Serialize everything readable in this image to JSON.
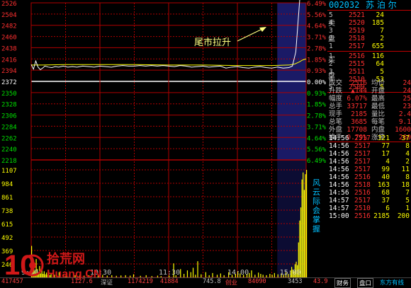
{
  "stock": {
    "code": "002032",
    "name": "苏 泊 尔"
  },
  "colors": {
    "up": "#ff3030",
    "down": "#00e000",
    "flat": "#ffffff",
    "grid": "#b00000",
    "price": "#ffffff",
    "avg": "#ffff00",
    "volume": "#ffff00",
    "label": "#00c0ff",
    "auction_bg": "#1a1a66"
  },
  "chart": {
    "price_ticks_left": [
      "2526",
      "2504",
      "2482",
      "2460",
      "2438",
      "2416",
      "2394",
      "2372",
      "2350",
      "2328",
      "2306",
      "2284",
      "2262",
      "2240",
      "2218"
    ],
    "pct_ticks_right": [
      "6.49%",
      "5.56%",
      "4.64%",
      "3.71%",
      "2.78%",
      "1.85%",
      "0.93%",
      "0.00%",
      "0.93%",
      "1.85%",
      "2.78%",
      "3.71%",
      "4.64%",
      "5.56%",
      "6.49%"
    ],
    "volume_ticks_left": [
      "1107",
      "984",
      "861",
      "738",
      "615",
      "492",
      "369",
      "246"
    ],
    "time_labels": [
      "9:30",
      "10:30",
      "11:30",
      "14:00",
      "15:00"
    ],
    "prev_close": 23.72,
    "price_range": [
      22.18,
      25.26
    ],
    "volume_max": 1230,
    "side_label": "风云际会掌握",
    "annotation": "尾市拉升",
    "price_series": [
      [
        0,
        24.05
      ],
      [
        2,
        23.96
      ],
      [
        4,
        24.12
      ],
      [
        6,
        24.0
      ],
      [
        8,
        23.95
      ],
      [
        10,
        23.98
      ],
      [
        12,
        24.02
      ],
      [
        15,
        24.0
      ],
      [
        18,
        23.99
      ],
      [
        21,
        24.01
      ],
      [
        24,
        24.0
      ],
      [
        28,
        24.02
      ],
      [
        32,
        24.0
      ],
      [
        36,
        24.01
      ],
      [
        40,
        24.0
      ],
      [
        45,
        24.02
      ],
      [
        50,
        24.01
      ],
      [
        55,
        24.0
      ],
      [
        60,
        24.02
      ],
      [
        65,
        24.01
      ],
      [
        70,
        24.0
      ],
      [
        75,
        24.02
      ],
      [
        80,
        24.03
      ],
      [
        85,
        24.02
      ],
      [
        90,
        24.02
      ],
      [
        95,
        24.03
      ],
      [
        100,
        24.02
      ],
      [
        105,
        24.03
      ],
      [
        110,
        24.02
      ],
      [
        115,
        24.03
      ],
      [
        120,
        24.02
      ],
      [
        125,
        24.01
      ],
      [
        130,
        24.03
      ],
      [
        135,
        24.02
      ],
      [
        140,
        24.0
      ],
      [
        145,
        24.01
      ],
      [
        150,
        24.02
      ],
      [
        155,
        24.0
      ],
      [
        160,
        24.01
      ],
      [
        165,
        24.02
      ],
      [
        170,
        23.98
      ],
      [
        175,
        24.0
      ],
      [
        180,
        24.01
      ],
      [
        185,
        23.99
      ],
      [
        190,
        23.98
      ],
      [
        195,
        24.0
      ],
      [
        200,
        24.01
      ],
      [
        205,
        23.99
      ],
      [
        210,
        23.98
      ],
      [
        215,
        24.0
      ],
      [
        220,
        23.98
      ],
      [
        225,
        23.99
      ],
      [
        228,
        24.02
      ],
      [
        231,
        24.3
      ],
      [
        233,
        24.9
      ],
      [
        235,
        25.5
      ],
      [
        236,
        25.7
      ],
      [
        237,
        25.6
      ],
      [
        238,
        25.62
      ],
      [
        239,
        25.65
      ],
      [
        240,
        25.66
      ]
    ],
    "avg_series": [
      [
        0,
        24.04
      ],
      [
        10,
        24.04
      ],
      [
        30,
        24.05
      ],
      [
        60,
        24.05
      ],
      [
        90,
        24.05
      ],
      [
        120,
        24.04
      ],
      [
        150,
        24.04
      ],
      [
        180,
        24.03
      ],
      [
        210,
        24.03
      ],
      [
        225,
        24.04
      ],
      [
        230,
        24.06
      ],
      [
        234,
        24.1
      ],
      [
        237,
        24.14
      ],
      [
        240,
        24.16
      ]
    ],
    "volume_bars": [
      [
        0,
        360
      ],
      [
        1,
        110
      ],
      [
        2,
        150
      ],
      [
        3,
        70
      ],
      [
        4,
        210
      ],
      [
        5,
        95
      ],
      [
        6,
        60
      ],
      [
        7,
        130
      ],
      [
        8,
        45
      ],
      [
        9,
        80
      ],
      [
        10,
        40
      ],
      [
        11,
        70
      ],
      [
        12,
        35
      ],
      [
        13,
        55
      ],
      [
        14,
        30
      ],
      [
        15,
        65
      ],
      [
        16,
        25
      ],
      [
        17,
        40
      ],
      [
        20,
        30
      ],
      [
        24,
        60
      ],
      [
        28,
        35
      ],
      [
        30,
        20
      ],
      [
        33,
        40
      ],
      [
        38,
        25
      ],
      [
        42,
        30
      ],
      [
        46,
        20
      ],
      [
        50,
        25
      ],
      [
        55,
        30
      ],
      [
        58,
        22
      ],
      [
        62,
        28
      ],
      [
        66,
        20
      ],
      [
        70,
        25
      ],
      [
        74,
        18
      ],
      [
        78,
        22
      ],
      [
        82,
        25
      ],
      [
        86,
        20
      ],
      [
        89,
        35
      ],
      [
        95,
        18
      ],
      [
        100,
        25
      ],
      [
        105,
        15
      ],
      [
        110,
        20
      ],
      [
        113,
        15
      ],
      [
        120,
        22
      ],
      [
        124,
        160
      ],
      [
        126,
        25
      ],
      [
        130,
        95
      ],
      [
        133,
        40
      ],
      [
        136,
        80
      ],
      [
        139,
        60
      ],
      [
        141,
        110
      ],
      [
        143,
        30
      ],
      [
        145,
        185
      ],
      [
        148,
        35
      ],
      [
        152,
        60
      ],
      [
        155,
        25
      ],
      [
        158,
        50
      ],
      [
        162,
        30
      ],
      [
        165,
        45
      ],
      [
        168,
        25
      ],
      [
        172,
        60
      ],
      [
        175,
        30
      ],
      [
        178,
        40
      ],
      [
        180,
        70
      ],
      [
        182,
        45
      ],
      [
        185,
        30
      ],
      [
        188,
        40
      ],
      [
        190,
        50
      ],
      [
        192,
        80
      ],
      [
        195,
        30
      ],
      [
        198,
        55
      ],
      [
        200,
        40
      ],
      [
        202,
        30
      ],
      [
        205,
        25
      ],
      [
        208,
        40
      ],
      [
        210,
        30
      ],
      [
        212,
        50
      ],
      [
        215,
        35
      ],
      [
        218,
        45
      ],
      [
        220,
        30
      ],
      [
        222,
        60
      ],
      [
        224,
        40
      ],
      [
        226,
        80
      ],
      [
        227,
        120
      ],
      [
        228,
        90
      ],
      [
        229,
        70
      ],
      [
        230,
        150
      ],
      [
        231,
        180
      ],
      [
        232,
        140
      ],
      [
        233,
        400
      ],
      [
        234,
        650
      ],
      [
        235,
        800
      ],
      [
        236,
        1120
      ],
      [
        237,
        1200
      ],
      [
        238,
        1000
      ],
      [
        239,
        1180
      ],
      [
        240,
        1230
      ]
    ]
  },
  "orderbook": {
    "sell_label": "卖\n盘",
    "buy_label": "买\n盘",
    "sells": [
      {
        "level": "5",
        "price": "2521",
        "vol": "24"
      },
      {
        "level": "4",
        "price": "2520",
        "vol": "185"
      },
      {
        "level": "3",
        "price": "2519",
        "vol": "7"
      },
      {
        "level": "2",
        "price": "2518",
        "vol": "2"
      },
      {
        "level": "1",
        "price": "2517",
        "vol": "655"
      }
    ],
    "buys": [
      {
        "level": "1",
        "price": "2516",
        "vol": "116"
      },
      {
        "level": "2",
        "price": "2515",
        "vol": "64"
      },
      {
        "level": "3",
        "price": "2511",
        "vol": "5"
      },
      {
        "level": "4",
        "price": "2510",
        "vol": "53"
      },
      {
        "level": "5",
        "price": "2509",
        "vol": "5"
      }
    ]
  },
  "stats": [
    {
      "l1": "成交",
      "v1": "2516",
      "l2": "均价",
      "v2": "24"
    },
    {
      "l1": "升跌",
      "v1": "▲144",
      "l2": "开盘",
      "v2": "24"
    },
    {
      "l1": "幅度",
      "v1": "6.07%",
      "l2": "最高",
      "v2": "25"
    },
    {
      "l1": "总手",
      "v1": "33717",
      "l2": "最低",
      "v2": "23"
    },
    {
      "l1": "现手",
      "v1": "2185",
      "l2": "量比",
      "v2": "2.4"
    },
    {
      "l1": "总笔",
      "v1": "3685",
      "l2": "每笔",
      "v2": "9.1"
    },
    {
      "l1": "外盘",
      "v1": "17708",
      "l2": "内盘",
      "v2": "1600"
    },
    {
      "l1": "换手",
      "v1": "0.79%",
      "l2": "涨停",
      "v2": "260"
    }
  ],
  "ticks": [
    {
      "time": "14:56",
      "price": "2517",
      "vol": "321",
      "extra": "37"
    },
    {
      "time": "14:56",
      "price": "2517",
      "vol": "77",
      "extra": "8"
    },
    {
      "time": "14:56",
      "price": "2517",
      "vol": "17",
      "extra": "4"
    },
    {
      "time": "14:56",
      "price": "2517",
      "vol": "4",
      "extra": "2"
    },
    {
      "time": "14:56",
      "price": "2517",
      "vol": "99",
      "extra": "11"
    },
    {
      "time": "14:56",
      "price": "2516",
      "vol": "40",
      "extra": "8"
    },
    {
      "time": "14:56",
      "price": "2518",
      "vol": "163",
      "extra": "18"
    },
    {
      "time": "14:56",
      "price": "2516",
      "vol": "68",
      "extra": "7"
    },
    {
      "time": "14:57",
      "price": "2517",
      "vol": "37",
      "extra": "5"
    },
    {
      "time": "14:57",
      "price": "2510",
      "vol": "6",
      "extra": "1"
    },
    {
      "time": "15:00",
      "price": "2516",
      "vol": "2185",
      "extra": "200"
    }
  ],
  "status": {
    "items": [
      "417457",
      "1127.6",
      "深证",
      "1174219",
      "41884",
      "745.8",
      "创业",
      "84090",
      "3453",
      "43.9"
    ],
    "tabs": [
      "财务",
      "盘口"
    ],
    "extra": "东方有线"
  },
  "watermark": {
    "cn": "拾荒网",
    "en": "Huang.CN",
    "num": "10"
  }
}
